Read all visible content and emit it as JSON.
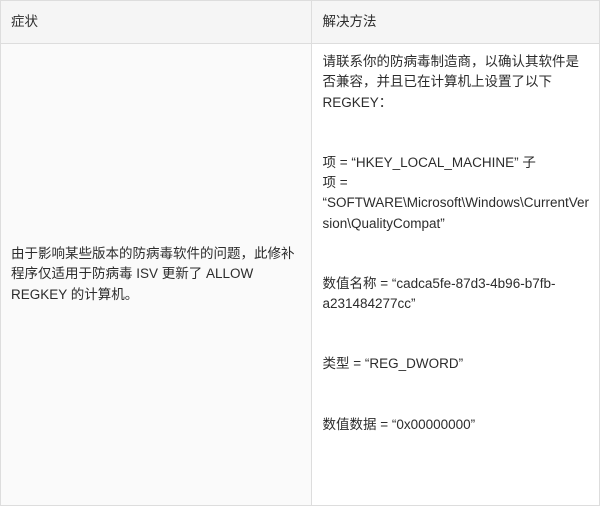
{
  "headers": {
    "symptom": "症状",
    "resolution": "解决方法"
  },
  "row": {
    "symptom_text": "由于影响某些版本的防病毒软件的问题，此修补程序仅适用于防病毒 ISV 更新了 ALLOW REGKEY 的计算机。",
    "resolution": {
      "intro": "请联系你的防病毒制造商，以确认其软件是否兼容，并且已在计算机上设置了以下 REGKEY：",
      "key_line1": "项 = “HKEY_LOCAL_MACHINE” 子",
      "key_line2": "项 = “SOFTWARE\\Microsoft\\Windows\\CurrentVersion\\QualityCompat”",
      "value_name": "数值名称 = “cadca5fe-87d3-4b96-b7fb-a231484277cc”",
      "type": "类型 = “REG_DWORD”",
      "data": "数值数据 = “0x00000000”"
    }
  }
}
